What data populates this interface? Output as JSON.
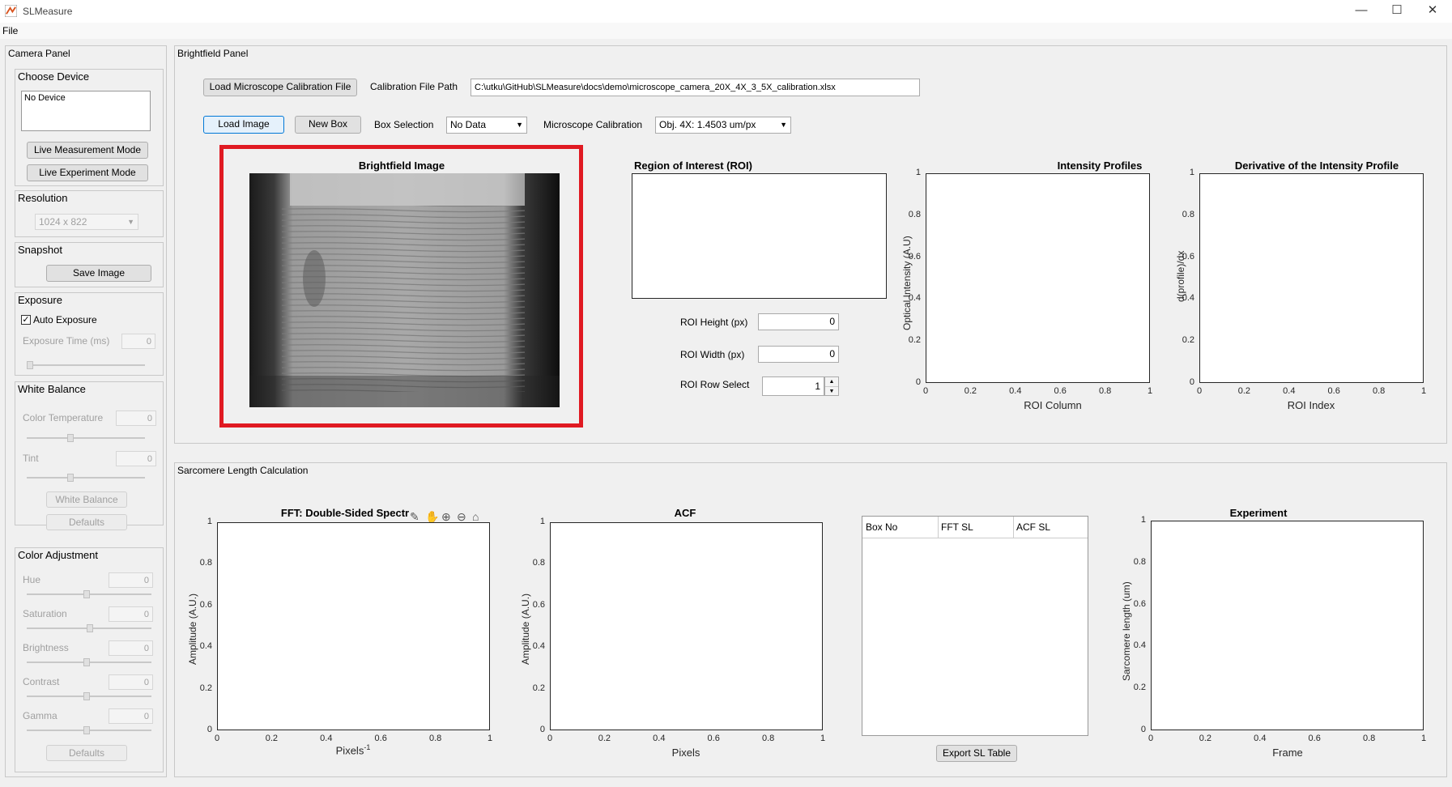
{
  "window": {
    "title": "SLMeasure",
    "minimize": "—",
    "maximize": "☐",
    "close": "✕"
  },
  "menu": {
    "file": "File"
  },
  "camera_panel": {
    "title": "Camera Panel",
    "choose_device": {
      "title": "Choose Device",
      "list_item": "No Device",
      "live_measurement": "Live Measurement Mode",
      "live_experiment": "Live Experiment Mode"
    },
    "resolution": {
      "title": "Resolution",
      "value": "1024 x 822"
    },
    "snapshot": {
      "title": "Snapshot",
      "save_image": "Save Image"
    },
    "exposure": {
      "title": "Exposure",
      "auto_exposure": "Auto Exposure",
      "auto_checked": true,
      "exposure_time_label": "Exposure Time (ms)",
      "exposure_time_value": "0"
    },
    "white_balance": {
      "title": "White Balance",
      "color_temp_label": "Color Temperature",
      "color_temp_value": "0",
      "tint_label": "Tint",
      "tint_value": "0",
      "white_balance_btn": "White Balance",
      "defaults_btn": "Defaults"
    },
    "color_adjustment": {
      "title": "Color Adjustment",
      "hue_label": "Hue",
      "hue_value": "0",
      "saturation_label": "Saturation",
      "saturation_value": "0",
      "brightness_label": "Brightness",
      "brightness_value": "0",
      "contrast_label": "Contrast",
      "contrast_value": "0",
      "gamma_label": "Gamma",
      "gamma_value": "0",
      "defaults_btn": "Defaults"
    }
  },
  "brightfield_panel": {
    "title": "Brightfield Panel",
    "load_calibration": "Load Microscope Calibration File",
    "calibration_path_label": "Calibration File Path",
    "calibration_path": "C:\\utku\\GitHub\\SLMeasure\\docs\\demo\\microscope_camera_20X_4X_3_5X_calibration.xlsx",
    "load_image": "Load Image",
    "new_box": "New Box",
    "box_selection_label": "Box Selection",
    "box_selection_value": "No Data",
    "microscope_calibration_label": "Microscope Calibration",
    "microscope_calibration_value": "Obj. 4X: 1.4503 um/px",
    "brightfield_title": "Brightfield Image",
    "roi_title": "Region of Interest (ROI)",
    "roi_height_label": "ROI Height (px)",
    "roi_height_value": "0",
    "roi_width_label": "ROI Width (px)",
    "roi_width_value": "0",
    "roi_row_label": "ROI Row Select",
    "roi_row_value": "1",
    "intensity": {
      "title": "Intensity Profiles",
      "xlabel": "ROI Column",
      "ylabel": "Optical Intensity (A.U)"
    },
    "derivative": {
      "title": "Derivative of the Intensity Profile",
      "xlabel": "ROI Index",
      "ylabel": "d(profile)/dx"
    }
  },
  "sl_panel": {
    "title": "Sarcomere Length Calculation",
    "fft": {
      "title": "FFT: Double-Sided Spectr",
      "xlabel": "Pixels",
      "xlabel_sup": "-1",
      "ylabel": "Amplitude (A.U.)"
    },
    "acf": {
      "title": "ACF",
      "xlabel": "Pixels",
      "ylabel": "Amplitude (A.U.)"
    },
    "table": {
      "headers": [
        "Box No",
        "FFT SL",
        "ACF SL"
      ],
      "export": "Export SL Table"
    },
    "experiment": {
      "title": "Experiment",
      "xlabel": "Frame",
      "ylabel": "Sarcomere length (um)"
    }
  },
  "ticks": [
    "0",
    "0.2",
    "0.4",
    "0.6",
    "0.8",
    "1"
  ],
  "colors": {
    "highlight": "#e01a22",
    "selected_border": "#0078d7"
  }
}
